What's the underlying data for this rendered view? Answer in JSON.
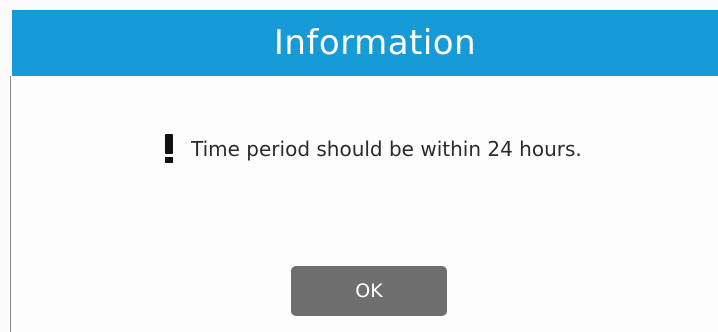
{
  "dialog": {
    "title": "Information",
    "icon": "exclamation-icon",
    "message": "Time period should be within 24 hours.",
    "ok_label": "OK"
  },
  "colors": {
    "title_bar": "#169bd8",
    "button": "#6e6e6e",
    "background": "#fbfbfb"
  }
}
